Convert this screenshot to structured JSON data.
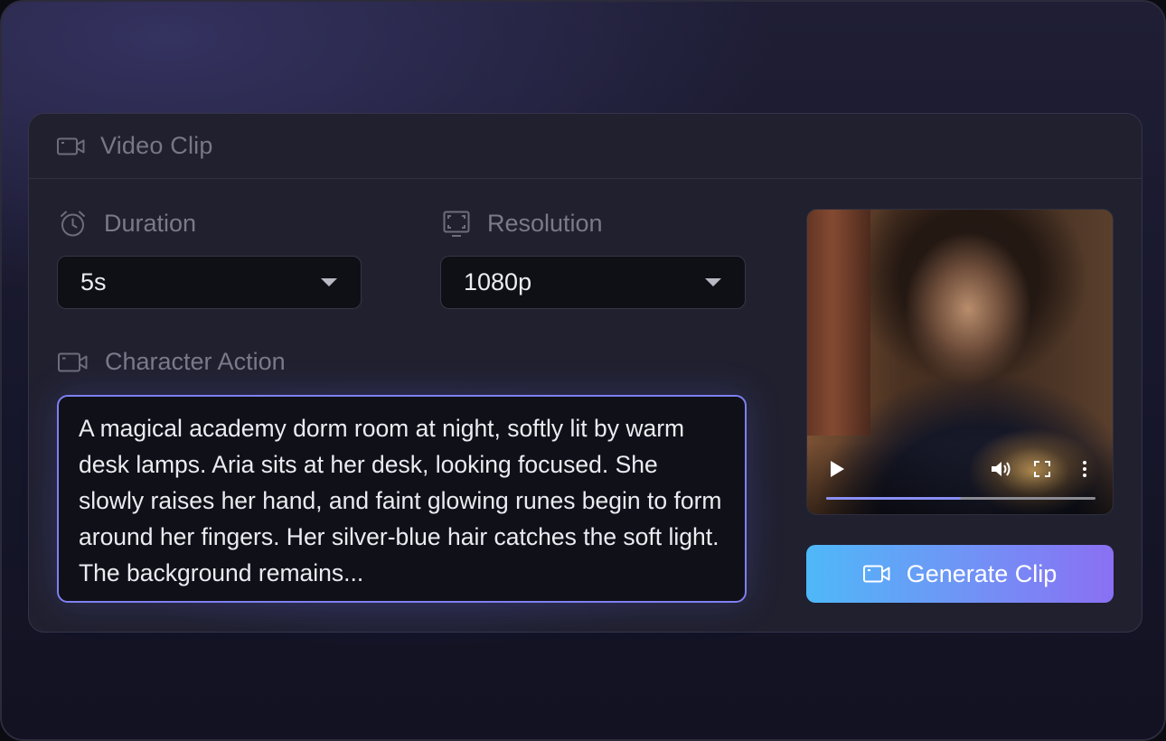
{
  "card": {
    "title": "Video Clip",
    "title_icon": "video-camera-icon"
  },
  "duration": {
    "label": "Duration",
    "icon": "alarm-clock-icon",
    "value": "5s"
  },
  "resolution": {
    "label": "Resolution",
    "icon": "screen-frame-icon",
    "value": "1080p"
  },
  "character_action": {
    "label": "Character Action",
    "icon": "video-camera-icon",
    "text": "A magical academy dorm room at night, softly lit by warm desk lamps. Aria sits at her desk, looking focused. She slowly raises her hand, and faint glowing runes begin to form around her fingers. Her silver-blue hair catches the soft light. The background remains..."
  },
  "video_preview": {
    "controls": [
      "play-icon",
      "volume-icon",
      "fullscreen-icon",
      "more-options-icon"
    ],
    "progress": 0.5
  },
  "generate_button": {
    "label": "Generate Clip",
    "icon": "video-camera-icon"
  },
  "colors": {
    "accent_start": "#4fb8f8",
    "accent_end": "#8a70f3",
    "focus_border": "#7e80f0",
    "progress": "#8a8ff5"
  }
}
